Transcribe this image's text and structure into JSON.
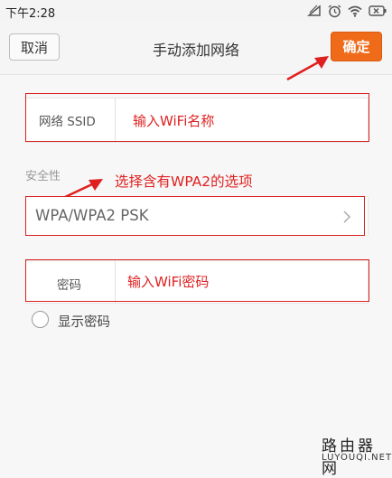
{
  "status_bar": {
    "time": "下午2:28",
    "icons": [
      "signal-muted-icon",
      "alarm-icon",
      "wifi-icon",
      "battery-icon"
    ]
  },
  "header": {
    "cancel_label": "取消",
    "title": "手动添加网络",
    "confirm_label": "确定"
  },
  "ssid": {
    "label": "网络 SSID",
    "hint": "输入WiFi名称"
  },
  "security": {
    "section_label": "安全性",
    "annotation": "选择含有WPA2的选项",
    "value": "WPA/WPA2 PSK"
  },
  "password": {
    "label": "密码",
    "hint": "输入WiFi密码"
  },
  "show_password": {
    "label": "显示密码",
    "checked": false
  },
  "watermark": {
    "cn": "路由器网",
    "en": "LUYOUQI.NET"
  },
  "colors": {
    "accent": "#ef6b1a",
    "annotation_red": "#e02020"
  }
}
